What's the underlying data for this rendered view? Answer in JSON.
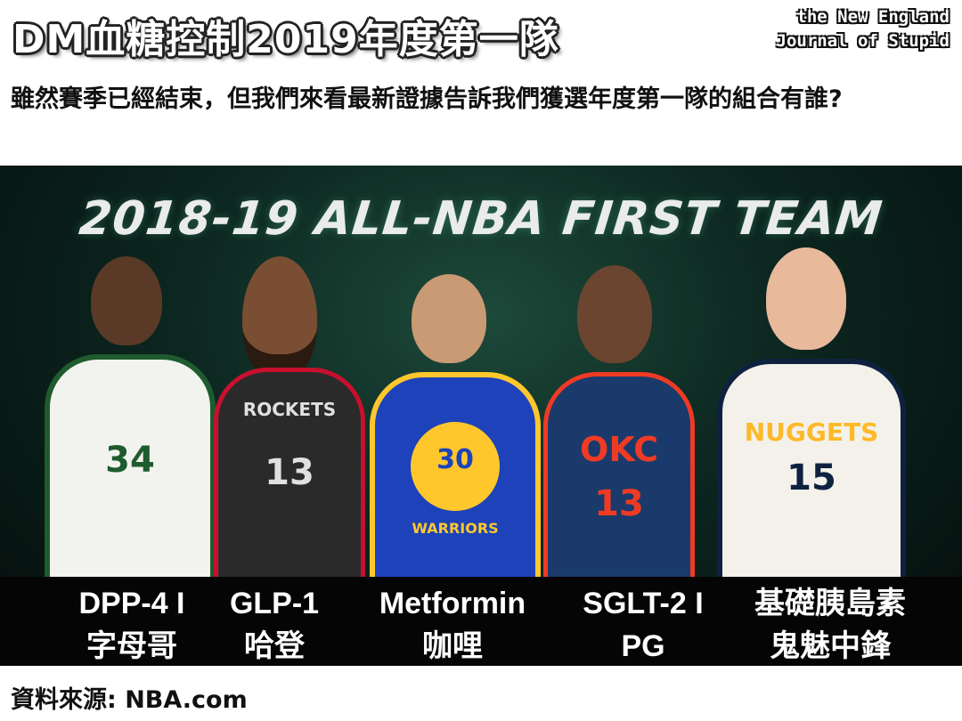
{
  "title": "DM血糖控制2019年度第一隊",
  "logo": {
    "line1": "the New England",
    "line2": "Journal of Stupid"
  },
  "subtitle": "雖然賽季已經結束，但我們來看最新證據告訴我們獲選年度第一隊的組合有誰?",
  "banner": "2018-19 ALL-NBA FIRST TEAM",
  "players": [
    {
      "drug": "DPP-4 I",
      "nickname": "字母哥",
      "jersey": "34",
      "team": "",
      "jersey_color": "#f2f2ee",
      "trim_color": "#1e5b2e",
      "skin": "#5a3a27"
    },
    {
      "drug": "GLP-1",
      "nickname": "哈登",
      "jersey": "13",
      "team": "ROCKETS",
      "jersey_color": "#2a2a2a",
      "trim_color": "#c8102e",
      "skin": "#7a4e33"
    },
    {
      "drug": "Metformin",
      "nickname": "咖哩",
      "jersey": "30",
      "team": "WARRIORS",
      "jersey_color": "#1d42ba",
      "trim_color": "#ffc72c",
      "skin": "#c99a74"
    },
    {
      "drug": "SGLT-2 I",
      "nickname": "PG",
      "jersey": "13",
      "team": "OKC",
      "jersey_color": "#1a3a6b",
      "trim_color": "#ef3b24",
      "skin": "#6b452f"
    },
    {
      "drug": "基礎胰島素",
      "nickname": "鬼魅中鋒",
      "jersey": "15",
      "team": "NUGGETS",
      "jersey_color": "#f4f1ea",
      "trim_color": "#0e2240",
      "skin": "#e8b99a"
    }
  ],
  "source": "資料來源: NBA.com"
}
